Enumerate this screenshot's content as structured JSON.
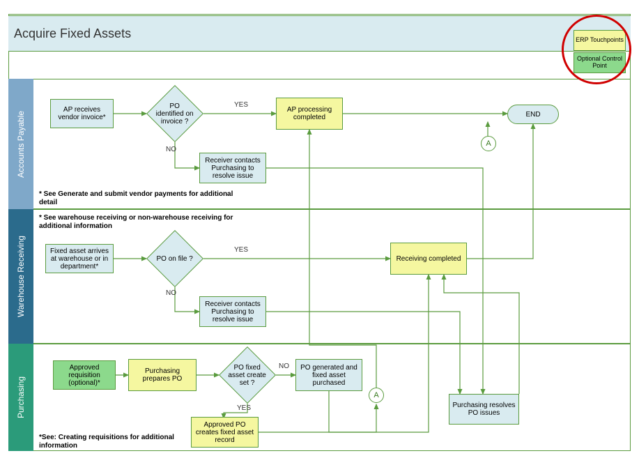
{
  "title": "Acquire Fixed Assets",
  "legend": {
    "erp": "ERP Touchpoints",
    "optional": "Optional Control Point"
  },
  "lanes": {
    "ap": "Accounts Payable",
    "wr": "Warehouse Receiving",
    "pu": "Purchasing"
  },
  "ap": {
    "recv": "AP receives vendor invoice*",
    "decision": "PO identified on invoice ?",
    "completed": "AP processing completed",
    "resolve": "Receiver contacts Purchasing to resolve issue",
    "footnote": "* See Generate and submit vendor payments for additional detail"
  },
  "wr": {
    "arrive": "Fixed asset arrives at warehouse or in department*",
    "decision": "PO on file ?",
    "completed": "Receiving completed",
    "resolve": "Receiver contacts Purchasing to resolve issue",
    "footnote": "* See warehouse receiving or non-warehouse receiving for additional information"
  },
  "pu": {
    "req": "Approved requisition (optional)*",
    "prepare": "Purchasing prepares PO",
    "decision": "PO fixed asset create set ?",
    "generated": "PO generated and fixed asset purchased",
    "approved": "Approved  PO creates fixed asset record",
    "resolve": "Purchasing resolves PO issues",
    "footnote": "*See: Creating requisitions for additional information"
  },
  "labels": {
    "yes": "YES",
    "no": "NO",
    "end": "END",
    "a": "A"
  }
}
